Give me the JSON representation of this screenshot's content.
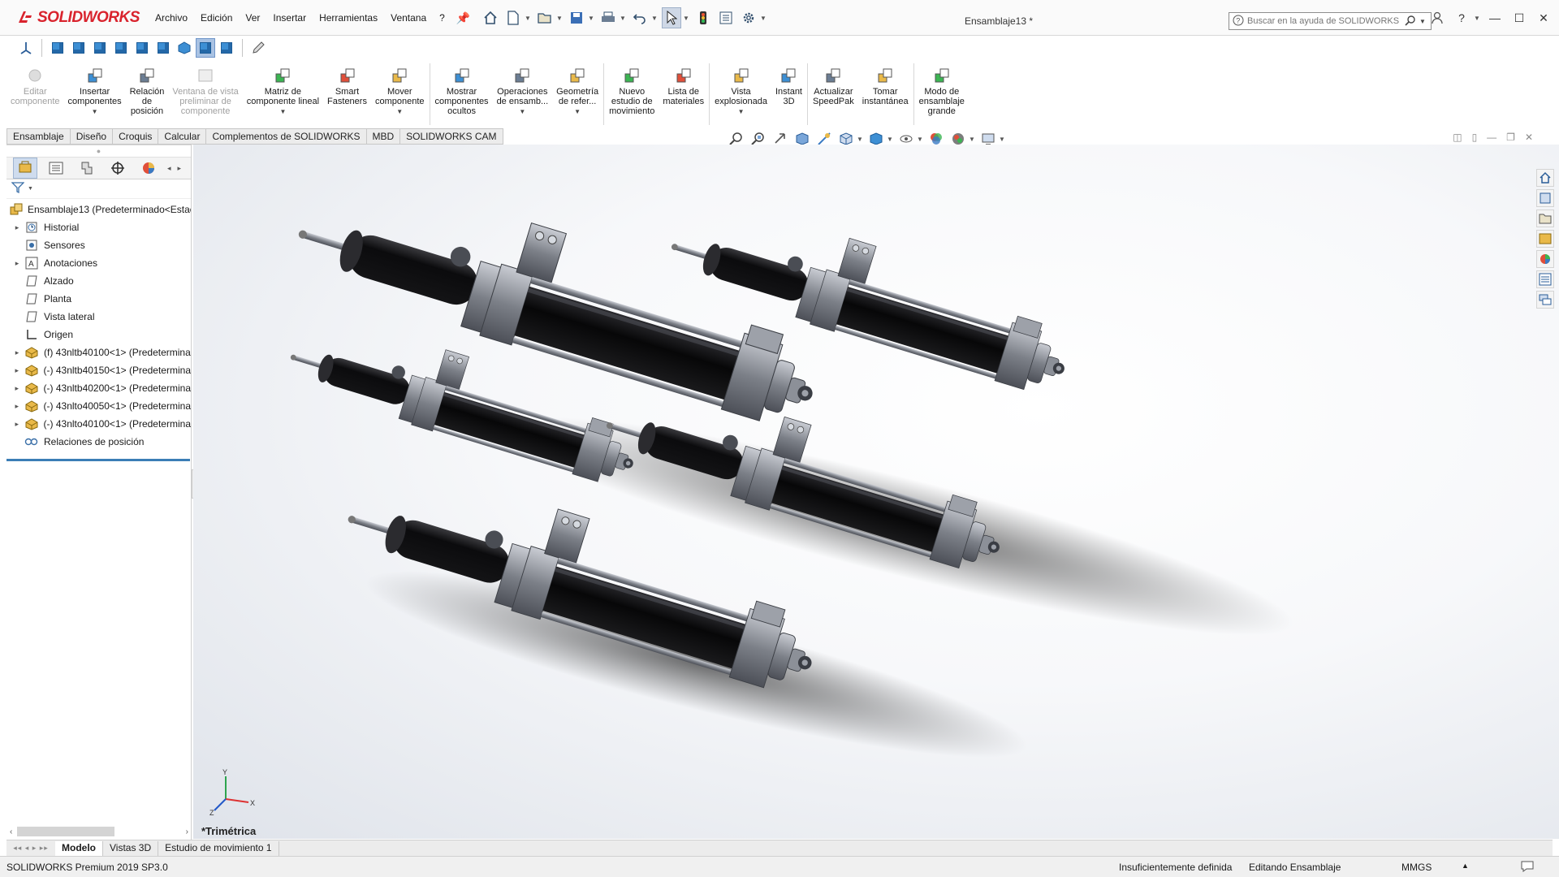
{
  "app": {
    "name": "SOLIDWORKS",
    "document_title": "Ensamblaje13 *"
  },
  "menu": [
    "Archivo",
    "Edición",
    "Ver",
    "Insertar",
    "Herramientas",
    "Ventana",
    "?"
  ],
  "search": {
    "placeholder": "Buscar en la ayuda de SOLIDWORKS"
  },
  "ribbon": [
    {
      "label": "Editar\ncomponente",
      "disabled": true,
      "icon": "edit-component-icon"
    },
    {
      "label": "Insertar\ncomponentes",
      "disabled": false,
      "icon": "insert-components-icon",
      "dropdown": true
    },
    {
      "label": "Relación\nde\nposición",
      "disabled": false,
      "icon": "mate-icon"
    },
    {
      "label": "Ventana de vista\npreliminar de\ncomponente",
      "disabled": true,
      "icon": "preview-window-icon"
    },
    {
      "label": "Matriz de\ncomponente lineal",
      "disabled": false,
      "icon": "linear-pattern-icon",
      "dropdown": true
    },
    {
      "label": "Smart\nFasteners",
      "disabled": false,
      "icon": "smart-fasteners-icon"
    },
    {
      "label": "Mover\ncomponente",
      "disabled": false,
      "icon": "move-component-icon",
      "dropdown": true
    },
    {
      "label": "Mostrar\ncomponentes\nocultos",
      "disabled": false,
      "icon": "show-hidden-icon"
    },
    {
      "label": "Operaciones\nde ensamb...",
      "disabled": false,
      "icon": "assembly-features-icon",
      "dropdown": true
    },
    {
      "label": "Geometría\nde refer...",
      "disabled": false,
      "icon": "reference-geometry-icon",
      "dropdown": true
    },
    {
      "label": "Nuevo\nestudio de\nmovimiento",
      "disabled": false,
      "icon": "motion-study-icon"
    },
    {
      "label": "Lista de\nmateriales",
      "disabled": false,
      "icon": "bom-icon"
    },
    {
      "label": "Vista\nexplosionada",
      "disabled": false,
      "icon": "exploded-view-icon",
      "dropdown": true
    },
    {
      "label": "Instant\n3D",
      "disabled": false,
      "icon": "instant3d-icon"
    },
    {
      "label": "Actualizar\nSpeedPak",
      "disabled": false,
      "icon": "speedpak-icon"
    },
    {
      "label": "Tomar\ninstantánea",
      "disabled": false,
      "icon": "snapshot-icon"
    },
    {
      "label": "Modo de\nensamblaje\ngrande",
      "disabled": false,
      "icon": "large-assembly-icon"
    }
  ],
  "tabs": [
    "Ensamblaje",
    "Diseño",
    "Croquis",
    "Calcular",
    "Complementos de SOLIDWORKS",
    "MBD",
    "SOLIDWORKS CAM"
  ],
  "active_tab": "Ensamblaje",
  "tree": {
    "root": "Ensamblaje13 (Predeterminado<Estac",
    "items": [
      {
        "label": "Historial",
        "expandable": true,
        "icon": "history-icon"
      },
      {
        "label": "Sensores",
        "expandable": false,
        "icon": "sensor-icon"
      },
      {
        "label": "Anotaciones",
        "expandable": true,
        "icon": "annotations-icon"
      },
      {
        "label": "Alzado",
        "expandable": false,
        "icon": "plane-icon"
      },
      {
        "label": "Planta",
        "expandable": false,
        "icon": "plane-icon"
      },
      {
        "label": "Vista lateral",
        "expandable": false,
        "icon": "plane-icon"
      },
      {
        "label": "Origen",
        "expandable": false,
        "icon": "origin-icon"
      },
      {
        "label": "(f) 43nltb40100<1> (Predetermina",
        "expandable": true,
        "icon": "component-icon"
      },
      {
        "label": "(-) 43nltb40150<1> (Predetermina",
        "expandable": true,
        "icon": "component-icon"
      },
      {
        "label": "(-) 43nltb40200<1> (Predetermina",
        "expandable": true,
        "icon": "component-icon"
      },
      {
        "label": "(-) 43nlto40050<1> (Predetermina",
        "expandable": true,
        "icon": "component-icon"
      },
      {
        "label": "(-) 43nlto40100<1> (Predetermina",
        "expandable": true,
        "icon": "component-icon"
      },
      {
        "label": "Relaciones de posición",
        "expandable": false,
        "icon": "mates-folder-icon"
      }
    ]
  },
  "viewport": {
    "view_name": "*Trimétrica",
    "triad": {
      "x": "X",
      "y": "Y",
      "z": "Z"
    }
  },
  "bottom_tabs": [
    "Modelo",
    "Vistas 3D",
    "Estudio de movimiento 1"
  ],
  "active_bottom_tab": "Modelo",
  "status": {
    "product": "SOLIDWORKS Premium 2019 SP3.0",
    "definition": "Insuficientemente definida",
    "mode": "Editando Ensamblaje",
    "units": "MMGS"
  },
  "colors": {
    "brand": "#d9232d",
    "accent": "#3b7eb6",
    "actuator_body": "#0c0c0e",
    "metal": "#8c8f96"
  }
}
